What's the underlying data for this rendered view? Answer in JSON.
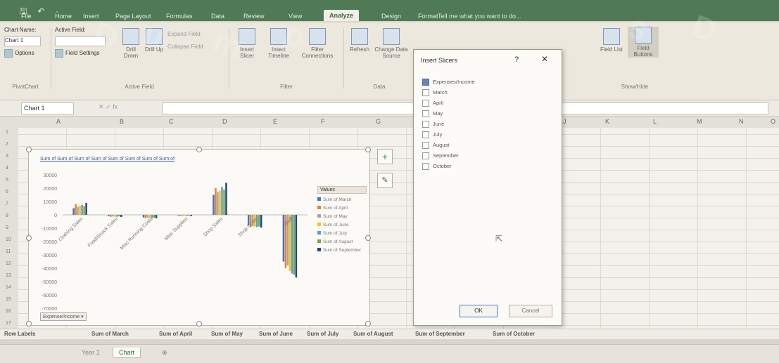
{
  "title_bar": {
    "quick_access": "🖫 ↶ ·"
  },
  "tabs": [
    "File",
    "Home",
    "Insert",
    "Page Layout",
    "Formulas",
    "Data",
    "Review",
    "View",
    "Analyze",
    "Design",
    "Format"
  ],
  "active_tab": "Analyze",
  "tell_me": "Tell me what you want to do...",
  "ribbon": {
    "chart_name_label": "Chart Name:",
    "chart_name_value": "Chart 1",
    "options_label": "Options",
    "pivotchart_label": "PivotChart",
    "active_field_label": "Active Field:",
    "field_settings_label": "Field Settings",
    "drill_down_label": "Drill Down",
    "drill_up_label": "Drill Up",
    "expand_field_label": "Expand Field",
    "collapse_field_label": "Collapse Field",
    "active_field_group": "Active Field",
    "insert_slicer_label": "Insert Slicer",
    "insert_timeline_label": "Insert Timeline",
    "filter_connections_label": "Filter Connections",
    "filter_group": "Filter",
    "refresh_label": "Refresh",
    "change_data_source_label": "Change Data Source",
    "data_group": "Data",
    "field_list_label": "Field List",
    "field_buttons_label": "Field Buttons",
    "show_hide_group": "Show/Hide"
  },
  "name_box": "Chart 1",
  "formula_icons": "✕ ✓ fx",
  "columns": [
    "A",
    "B",
    "C",
    "D",
    "E",
    "F",
    "G",
    "H",
    "I",
    "J",
    "K",
    "L",
    "M",
    "N",
    "O"
  ],
  "rows": [
    "1",
    "2",
    "3",
    "4",
    "5",
    "6",
    "7",
    "8",
    "9",
    "10",
    "11",
    "12",
    "13",
    "14",
    "15",
    "16",
    "17"
  ],
  "chart": {
    "field_buttons": "Sum of  Sum of  Sum of  Sum of  Sum of  Sum of  Sum of  Sum of",
    "legend_title": "Values",
    "legend": [
      {
        "name": "Sum of March",
        "color": "#4472c4"
      },
      {
        "name": "Sum of April",
        "color": "#ed7d31"
      },
      {
        "name": "Sum of May",
        "color": "#a5a5a5"
      },
      {
        "name": "Sum of June",
        "color": "#ffc000"
      },
      {
        "name": "Sum of July",
        "color": "#5b9bd5"
      },
      {
        "name": "Sum of August",
        "color": "#70ad47"
      },
      {
        "name": "Sum of September",
        "color": "#264478"
      }
    ],
    "filter_button": "Expense/Income ▾"
  },
  "chart_data": {
    "type": "bar",
    "categories": [
      "Clothing Sales",
      "Food/Snack Sales",
      "Misc Running Costs",
      "Misc Supplies",
      "Shop Sales",
      "Shop Costs",
      "Staff"
    ],
    "yticks": [
      30000,
      20000,
      10000,
      0,
      -10000,
      -20000,
      -30000,
      -40000,
      -50000,
      -60000,
      -70000
    ],
    "ylim": [
      -70000,
      30000
    ],
    "series": [
      {
        "name": "Sum of March",
        "values": [
          5000,
          -1000,
          -2000,
          -500,
          15000,
          -8000,
          -35000
        ]
      },
      {
        "name": "Sum of April",
        "values": [
          8000,
          -1500,
          -2500,
          -800,
          20000,
          -9000,
          -40000
        ]
      },
      {
        "name": "Sum of May",
        "values": [
          6000,
          -1200,
          -2200,
          -600,
          17000,
          -8500,
          -38000
        ]
      },
      {
        "name": "Sum of June",
        "values": [
          7000,
          -1300,
          -2300,
          -700,
          18000,
          -8800,
          -42000
        ]
      },
      {
        "name": "Sum of July",
        "values": [
          7500,
          -1400,
          -2400,
          -750,
          21000,
          -9200,
          -44000
        ]
      },
      {
        "name": "Sum of August",
        "values": [
          6500,
          -1100,
          -2100,
          -650,
          19000,
          -8700,
          -45000
        ]
      },
      {
        "name": "Sum of September",
        "values": [
          9000,
          -1600,
          -2600,
          -900,
          24000,
          -9500,
          -47000
        ]
      }
    ]
  },
  "dialog": {
    "title": "Insert Slicers",
    "help": "?",
    "close": "✕",
    "items": [
      {
        "label": "Expenses/Income",
        "checked": true
      },
      {
        "label": "March",
        "checked": false
      },
      {
        "label": "April",
        "checked": false
      },
      {
        "label": "May",
        "checked": false
      },
      {
        "label": "June",
        "checked": false
      },
      {
        "label": "July",
        "checked": false
      },
      {
        "label": "August",
        "checked": false
      },
      {
        "label": "September",
        "checked": false
      },
      {
        "label": "October",
        "checked": false
      }
    ],
    "ok": "OK",
    "cancel": "Cancel"
  },
  "pivot_headers": [
    "Row Labels",
    "Sum of March",
    "Sum of April",
    "Sum of May",
    "Sum of June",
    "Sum of July",
    "Sum of August",
    "Sum of September",
    "Sum of October"
  ],
  "sheets": [
    "Year 1",
    "Chart"
  ],
  "active_sheet": "Chart",
  "add_sheet": "⊕"
}
